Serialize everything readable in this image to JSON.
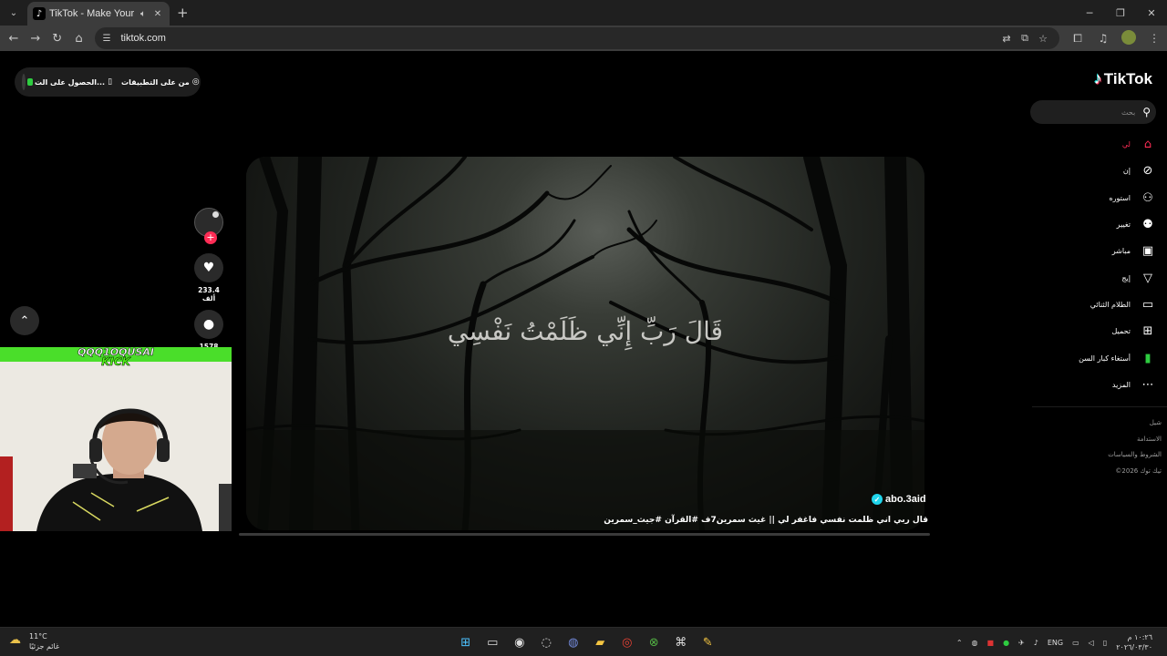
{
  "browser": {
    "tab": {
      "favicon": "tiktok-icon",
      "title": "TikTok - Make Your Day",
      "audio_icon": "speaker-icon",
      "close_icon": "close-icon"
    },
    "new_tab": "+",
    "window_controls": [
      "minimize-icon",
      "restore-icon",
      "close-icon"
    ],
    "url": "tiktok.com"
  },
  "page": {
    "get_app": {
      "item1": "من على التطبيقات",
      "item2": "الحصول على الت..."
    },
    "logo": "TikTok",
    "search_placeholder": "بحث",
    "nav": [
      {
        "label": "لي",
        "icon": "home-icon",
        "active": true
      },
      {
        "label": "إن",
        "icon": "compass-icon"
      },
      {
        "label": "استوره",
        "icon": "user-add-icon"
      },
      {
        "label": "تغيير",
        "icon": "friends-icon"
      },
      {
        "label": "مباشر",
        "icon": "live-icon"
      },
      {
        "label": "إيج",
        "icon": "send-icon"
      },
      {
        "label": "الطلام الثنائي",
        "icon": "message-icon"
      },
      {
        "label": "تحميل",
        "icon": "upload-icon"
      },
      {
        "label": "أستغاء كبار السن",
        "icon": "avatar-icon"
      },
      {
        "label": "المزيد",
        "icon": "more-icon"
      }
    ],
    "footer": [
      "شيل",
      "الاستدامة",
      "الشروط والسياسات",
      "©2026 تيك توك"
    ],
    "video": {
      "verse": "قَالَ رَبِّ إِنِّي ظَلَمْتُ نَفْسِي",
      "author": "abo.3aid",
      "caption": "قال ربي اني ظلمت نفسي فاغفر لي || غيث سمرين7ف #القرآن #جيث_سمرين",
      "progress": 0
    },
    "actions": {
      "likes": "233.4 ألف",
      "comments": "1578"
    },
    "webcam": {
      "name": "QQQ1OQUSAI",
      "platform": "KICK"
    }
  },
  "taskbar": {
    "weather_temp": "11°C",
    "weather_desc": "غائم جزئيًا",
    "apps": [
      "windows-icon",
      "task-view-icon",
      "steam-icon",
      "app-icon",
      "discord-icon",
      "folder-icon",
      "chrome-icon",
      "xbox-icon",
      "capcut-icon",
      "notes-icon"
    ],
    "lang": "ENG",
    "time": "١٠:٢٦ م",
    "date": "٢٠٢٦/٠٣/٣٠"
  },
  "colors": {
    "accent": "#fe2c55",
    "kick_green": "#53fc18",
    "verified": "#20d5ec"
  }
}
